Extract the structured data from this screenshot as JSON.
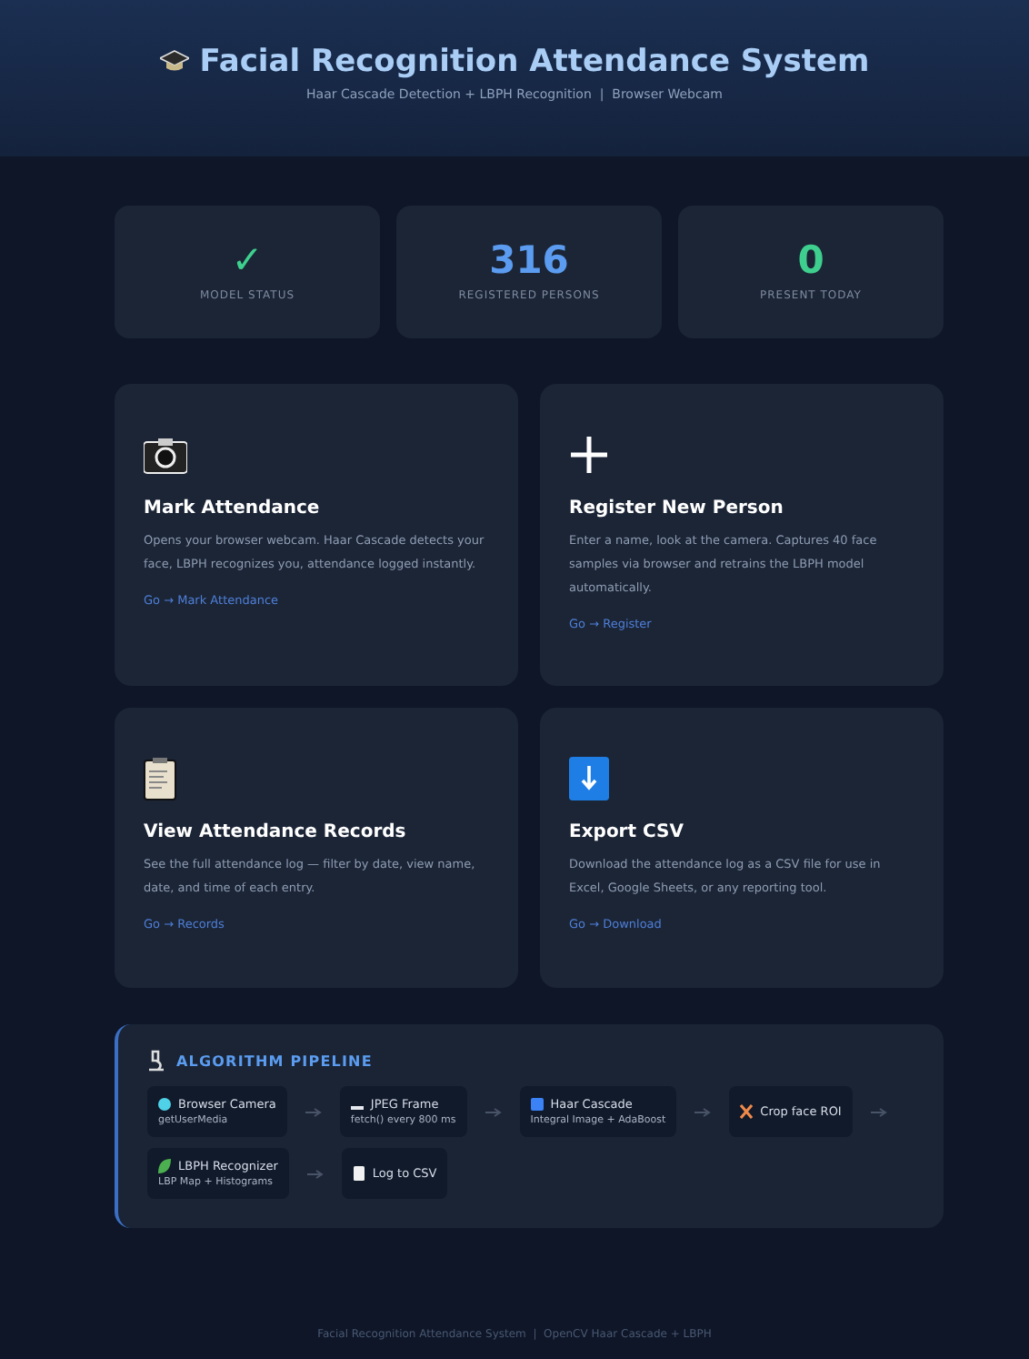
{
  "header": {
    "title": "Facial Recognition Attendance System",
    "subtitle": "Haar Cascade Detection + LBPH Recognition  |  Browser Webcam"
  },
  "stats": [
    {
      "value": "✓",
      "label": "MODEL STATUS",
      "color": "#3ecf8e"
    },
    {
      "value": "316",
      "label": "REGISTERED PERSONS",
      "color": "#5b9cf0"
    },
    {
      "value": "0",
      "label": "PRESENT TODAY",
      "color": "#3ecf8e"
    }
  ],
  "cards": [
    {
      "kind": "camera",
      "title": "Mark Attendance",
      "text": "Opens your browser webcam. Haar Cascade detects your face, LBPH recognizes you, attendance logged instantly.",
      "link": "Go → Mark Attendance"
    },
    {
      "kind": "plus",
      "title": "Register New Person",
      "text": "Enter a name, look at the camera. Captures 40 face samples via browser and retrains the LBPH model automatically.",
      "link": "Go → Register"
    },
    {
      "kind": "clipboard",
      "title": "View Attendance Records",
      "text": "See the full attendance log — filter by date, view name, date, and time of each entry.",
      "link": "Go → Records"
    },
    {
      "kind": "download",
      "title": "Export CSV",
      "text": "Download the attendance log as a CSV file for use in Excel, Google Sheets, or any reporting tool.",
      "link": "Go → Download"
    }
  ],
  "pipeline": {
    "title": "ALGORITHM PIPELINE",
    "steps": [
      {
        "kind": "dot",
        "color": "#4fd1e8",
        "name": "Browser Camera",
        "detail": "getUserMedia"
      },
      {
        "kind": "bar",
        "color": "#e6e9f0",
        "name": "JPEG Frame",
        "detail": "fetch() every 800 ms"
      },
      {
        "kind": "square",
        "color": "#3b82f6",
        "name": "Haar Cascade",
        "detail": "Integral Image + AdaBoost"
      },
      {
        "kind": "cross",
        "color": "#f08a4b",
        "name": "Crop face ROI"
      },
      {
        "kind": "leaf",
        "color": "#4caf50",
        "name": "LBPH Recognizer",
        "detail": "LBP Map + Histograms"
      },
      {
        "kind": "page",
        "color": "#f2f2f2",
        "name": "Log to CSV"
      }
    ]
  },
  "footer": "Facial Recognition Attendance System  |  OpenCV Haar Cascade + LBPH"
}
